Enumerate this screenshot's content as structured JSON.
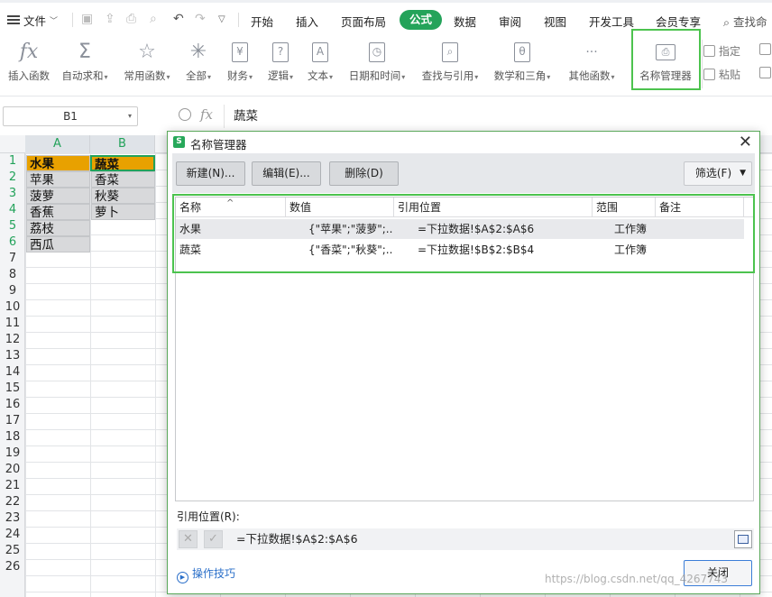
{
  "menubar": {
    "file_label": "文件",
    "tabs": [
      "开始",
      "插入",
      "页面布局",
      "公式",
      "数据",
      "审阅",
      "视图",
      "开发工具",
      "会员专享"
    ],
    "active_tab": "公式",
    "search_label": "查找命"
  },
  "ribbon": {
    "buttons": [
      {
        "label": "插入函数",
        "icon": "fx-icon",
        "glyph": "fx",
        "caret": false
      },
      {
        "label": "自动求和",
        "icon": "sigma-icon",
        "glyph": "Σ",
        "caret": true
      },
      {
        "label": "常用函数",
        "icon": "star-icon",
        "glyph": "☆",
        "caret": true
      },
      {
        "label": "全部",
        "icon": "asterisk-icon",
        "glyph": "✳",
        "caret": true
      },
      {
        "label": "财务",
        "icon": "yen-icon",
        "glyph": "¥",
        "caret": true
      },
      {
        "label": "逻辑",
        "icon": "question-icon",
        "glyph": "?",
        "caret": true
      },
      {
        "label": "文本",
        "icon": "text-a-icon",
        "glyph": "A",
        "caret": true
      },
      {
        "label": "日期和时间",
        "icon": "clock-icon",
        "glyph": "◷",
        "caret": true
      },
      {
        "label": "查找与引用",
        "icon": "magnifier-icon",
        "glyph": "⌕",
        "caret": true
      },
      {
        "label": "数学和三角",
        "icon": "theta-icon",
        "glyph": "θ",
        "caret": true
      },
      {
        "label": "其他函数",
        "icon": "more-dots-icon",
        "glyph": "···",
        "caret": true
      },
      {
        "label": "名称管理器",
        "icon": "name-manager-icon",
        "glyph": "⎙",
        "caret": false
      }
    ],
    "small": {
      "define_label": "指定",
      "paste_label": "粘贴"
    }
  },
  "formula_bar": {
    "name_box": "B1",
    "fx": "fx",
    "content": "蔬菜"
  },
  "sheet": {
    "columns": [
      "A",
      "B"
    ],
    "rows": [
      "1",
      "2",
      "3",
      "4",
      "5",
      "6",
      "7",
      "8",
      "9",
      "10",
      "11",
      "12",
      "13",
      "14",
      "15",
      "16",
      "17",
      "18",
      "19",
      "20",
      "21",
      "22",
      "23",
      "24",
      "25",
      "26"
    ],
    "col_a": [
      "水果",
      "苹果",
      "菠萝",
      "香蕉",
      "荔枝",
      "西瓜"
    ],
    "col_b": [
      "蔬菜",
      "香菜",
      "秋葵",
      "萝卜"
    ]
  },
  "dialog": {
    "title": "名称管理器",
    "buttons": {
      "new": "新建(N)...",
      "edit": "编辑(E)...",
      "delete": "删除(D)",
      "filter": "筛选(F)"
    },
    "columns": {
      "name": "名称",
      "value": "数值",
      "refers_to": "引用位置",
      "scope": "范围",
      "comment": "备注"
    },
    "rows": [
      {
        "name": "水果",
        "value": "{\"苹果\";\"菠萝\";...",
        "refers_to": "=下拉数据!$A$2:$A$6",
        "scope": "工作簿",
        "comment": ""
      },
      {
        "name": "蔬菜",
        "value": "{\"香菜\";\"秋葵\";...",
        "refers_to": "=下拉数据!$B$2:$B$4",
        "scope": "工作簿",
        "comment": ""
      }
    ],
    "ref_label": "引用位置(R):",
    "ref_value": "=下拉数据!$A$2:$A$6",
    "tips": "操作技巧",
    "close": "关闭"
  },
  "watermark": "https://blog.csdn.net/qq_4267743"
}
